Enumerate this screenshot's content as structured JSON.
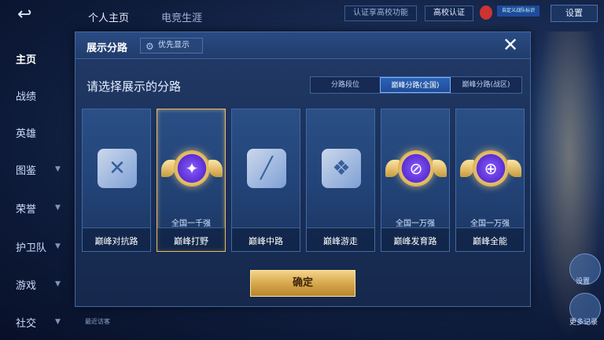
{
  "topbar": {
    "tabs": [
      "个人主页",
      "电竞生涯"
    ],
    "cert_badge": "认证享高校功能",
    "edu_badge": "高校认证",
    "mini_badge": "自定义战队标识",
    "settings": "设置"
  },
  "sidebar": {
    "items": [
      "主页",
      "战绩",
      "英雄",
      "图鉴",
      "荣誉",
      "护卫队",
      "游戏",
      "社交"
    ]
  },
  "background": {
    "visitors_label": "最近访客",
    "right_btn_1": "设置",
    "right_btn_2": "更多记录"
  },
  "modal": {
    "title": "展示分路",
    "priority_button": "优先显示",
    "close_icon": "close-icon",
    "prompt": "请选择展示的分路",
    "segments": [
      "分路段位",
      "巅峰分路(全国)",
      "巅峰分路(战区)"
    ],
    "selected_segment": "巅峰分路(全国)",
    "cards": [
      {
        "label": "巅峰对抗路",
        "rank": "",
        "icon": "lane-icon",
        "ranked": false
      },
      {
        "label": "巅峰打野",
        "rank": "全国一千强",
        "icon": "rank-emblem-icon",
        "ranked": true
      },
      {
        "label": "巅峰中路",
        "rank": "",
        "icon": "lane-icon",
        "ranked": false
      },
      {
        "label": "巅峰游走",
        "rank": "",
        "icon": "lane-icon",
        "ranked": false
      },
      {
        "label": "巅峰发育路",
        "rank": "全国一万强",
        "icon": "rank-emblem-icon",
        "ranked": true
      },
      {
        "label": "巅峰全能",
        "rank": "全国一万强",
        "icon": "rank-emblem-icon",
        "ranked": true
      }
    ],
    "selected_card": "巅峰打野",
    "confirm": "确定"
  },
  "colors": {
    "accent_gold": "#e6b96a",
    "segment_active": "#2c63b8",
    "modal_bg": "#213a66"
  }
}
